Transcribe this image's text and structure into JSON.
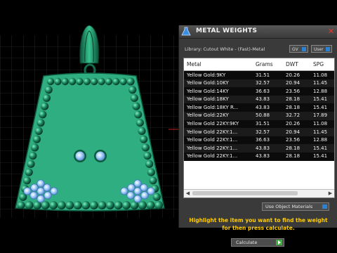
{
  "window": {
    "title": "METAL WEIGHTS",
    "close_glyph": "✕"
  },
  "library": {
    "label": "Library: Cutout White - (Fast)-Metal",
    "gv_button": "GV",
    "user_button": "User"
  },
  "table": {
    "columns": [
      "Metal",
      "Grams",
      "DWT",
      "SPG"
    ],
    "rows": [
      {
        "metal": "Yellow Gold:9KY",
        "grams": "31.51",
        "dwt": "20.26",
        "spg": "11.08"
      },
      {
        "metal": "Yellow Gold:10KY",
        "grams": "32.57",
        "dwt": "20.94",
        "spg": "11.45"
      },
      {
        "metal": "Yellow Gold:14KY",
        "grams": "36.63",
        "dwt": "23.56",
        "spg": "12.88"
      },
      {
        "metal": "Yellow Gold:18KY",
        "grams": "43.83",
        "dwt": "28.18",
        "spg": "15.41"
      },
      {
        "metal": "Yellow Gold:18KY R...",
        "grams": "43.83",
        "dwt": "28.18",
        "spg": "15.41"
      },
      {
        "metal": "Yellow Gold:22KY",
        "grams": "50.88",
        "dwt": "32.72",
        "spg": "17.89"
      },
      {
        "metal": "Yellow Gold 22KY:9KY",
        "grams": "31.51",
        "dwt": "20.26",
        "spg": "11.08"
      },
      {
        "metal": "Yellow Gold 22KY:1...",
        "grams": "32.57",
        "dwt": "20.94",
        "spg": "11.45"
      },
      {
        "metal": "Yellow Gold 22KY:1...",
        "grams": "36.63",
        "dwt": "23.56",
        "spg": "12.88"
      },
      {
        "metal": "Yellow Gold 22KY:1...",
        "grams": "43.83",
        "dwt": "28.18",
        "spg": "15.41"
      },
      {
        "metal": "Yellow Gold 22KY:1...",
        "grams": "43.83",
        "dwt": "28.18",
        "spg": "15.41"
      }
    ]
  },
  "use_object_materials": "Use Object Materials",
  "hint": {
    "line1": "Highlight the item you want to find the weight",
    "line2": "for then press calculate."
  },
  "calculate_button": "Calculate",
  "colors": {
    "accent_yellow": "#ffcc00",
    "pendant_green": "#2fae82",
    "gem_blue": "#9ec9f5",
    "button_blue": "#2a82d6"
  }
}
